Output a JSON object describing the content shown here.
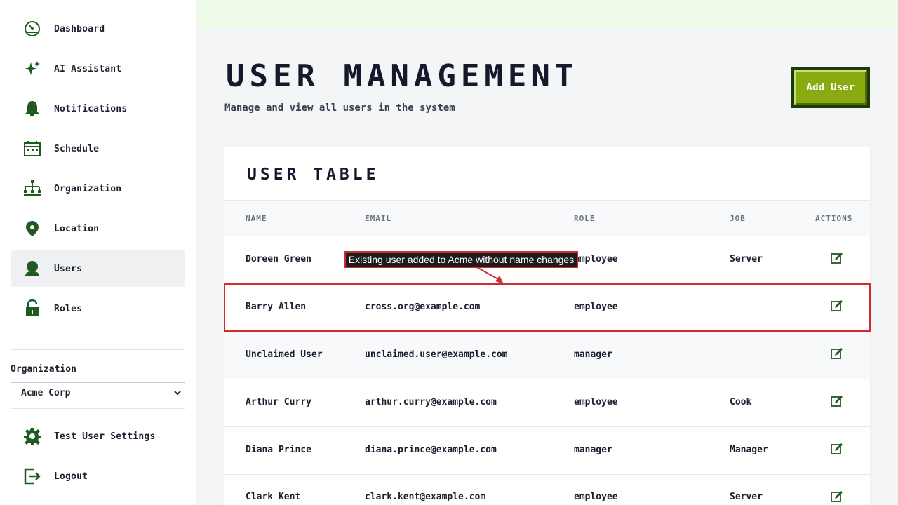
{
  "sidebar": {
    "nav_items": [
      {
        "label": "Dashboard",
        "icon": "dashboard-icon"
      },
      {
        "label": "AI Assistant",
        "icon": "sparkle-icon"
      },
      {
        "label": "Notifications",
        "icon": "bell-icon"
      },
      {
        "label": "Schedule",
        "icon": "calendar-icon"
      },
      {
        "label": "Organization",
        "icon": "org-chart-icon"
      },
      {
        "label": "Location",
        "icon": "map-pin-icon"
      },
      {
        "label": "Users",
        "icon": "user-icon",
        "active": true
      },
      {
        "label": "Roles",
        "icon": "lock-icon"
      }
    ],
    "org_label": "Organization",
    "org_selected": "Acme Corp",
    "footer_items": [
      {
        "label": "Test User Settings",
        "icon": "gear-icon"
      },
      {
        "label": "Logout",
        "icon": "logout-icon"
      }
    ]
  },
  "header": {
    "title": "User Management",
    "subtitle": "Manage and view all users in the system",
    "add_user_label": "Add User"
  },
  "table": {
    "title": "User Table",
    "columns": [
      "Name",
      "Email",
      "Role",
      "Job",
      "Actions"
    ],
    "rows": [
      {
        "name": "Doreen Green",
        "email": "",
        "role": "employee",
        "job": "Server"
      },
      {
        "name": "Barry Allen",
        "email": "cross.org@example.com",
        "role": "employee",
        "job": ""
      },
      {
        "name": "Unclaimed User",
        "email": "unclaimed.user@example.com",
        "role": "manager",
        "job": ""
      },
      {
        "name": "Arthur Curry",
        "email": "arthur.curry@example.com",
        "role": "employee",
        "job": "Cook"
      },
      {
        "name": "Diana Prince",
        "email": "diana.prince@example.com",
        "role": "manager",
        "job": "Manager"
      },
      {
        "name": "Clark Kent",
        "email": "clark.kent@example.com",
        "role": "employee",
        "job": "Server"
      }
    ]
  },
  "annotation": {
    "text": "Existing user added to Acme without name changes"
  },
  "colors": {
    "accent_green": "#8aab10",
    "icon_green": "#1f5a22",
    "highlight_red": "#d22b2b"
  }
}
